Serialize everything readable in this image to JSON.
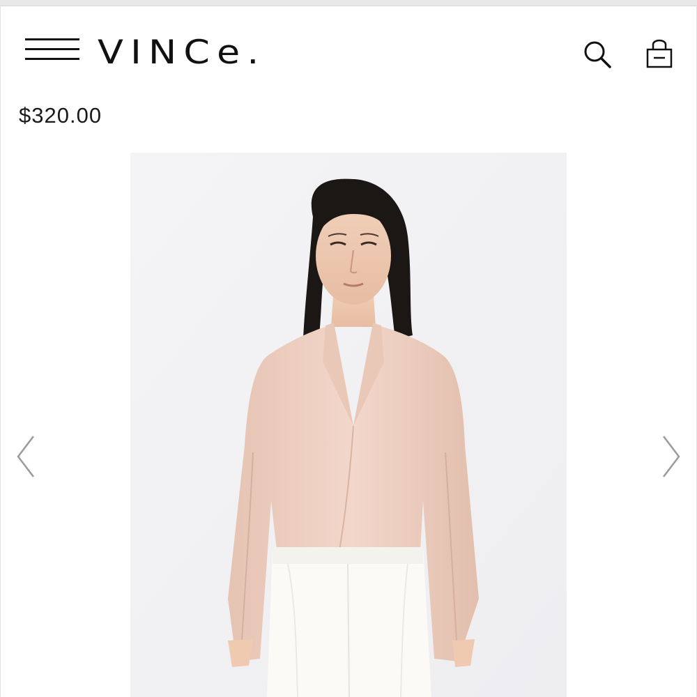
{
  "header": {
    "brand": "VINCe."
  },
  "icons": {
    "menu": "hamburger-menu-icon",
    "search": "search-icon",
    "bag": "shopping-bag-icon",
    "prev": "chevron-left-icon",
    "next": "chevron-right-icon"
  },
  "product": {
    "price": "$320.00"
  },
  "colors": {
    "text": "#111111",
    "image_background": "#f1f1f3",
    "blouse": "#efd3c6",
    "trousers": "#fbfaf6",
    "hair": "#1a1614",
    "arrow": "#9a9a9a"
  }
}
